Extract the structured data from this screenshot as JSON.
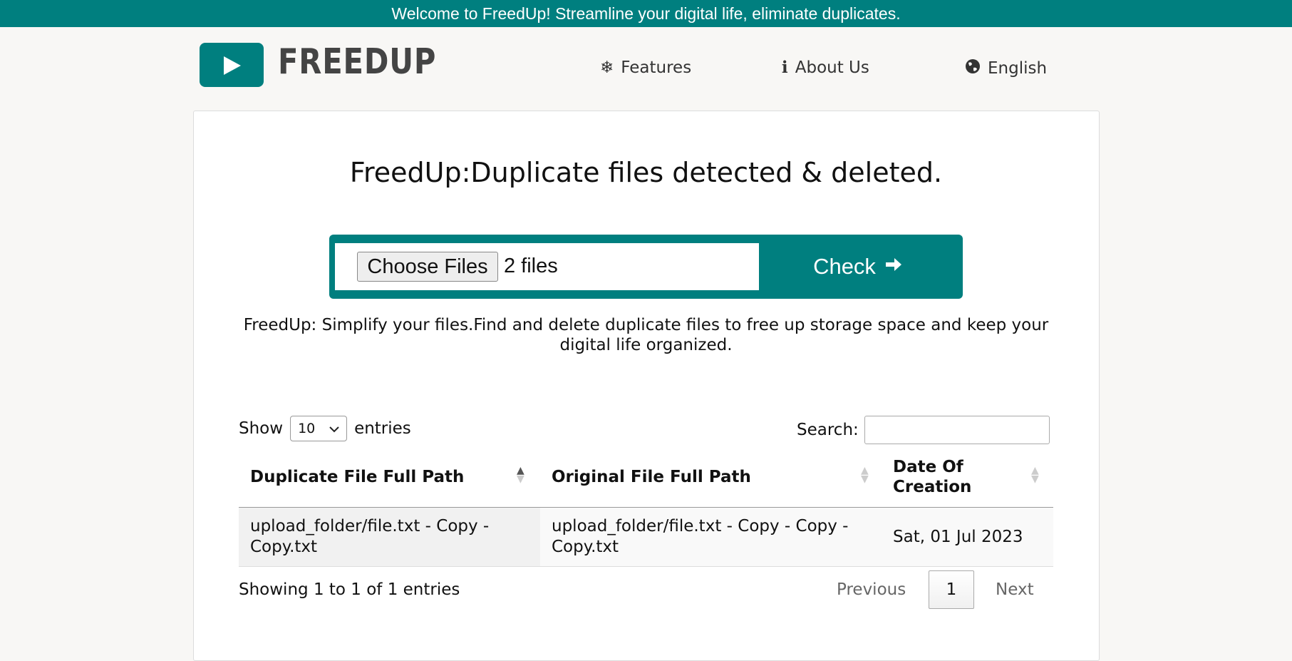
{
  "banner": {
    "text": "Welcome to FreedUp! Streamline your digital life, eliminate duplicates."
  },
  "header": {
    "logo_text": "FREEDUP",
    "nav": [
      {
        "icon": "snowflake-icon",
        "label": "Features"
      },
      {
        "icon": "info-icon",
        "label": "About Us"
      },
      {
        "icon": "globe-icon",
        "label": "English"
      }
    ]
  },
  "main": {
    "title": "FreedUp:Duplicate files detected & deleted.",
    "upload": {
      "choose_label": "Choose Files",
      "files_selected": "2 files",
      "check_label": "Check"
    },
    "description": "FreedUp: Simplify your files.Find and delete duplicate files to free up storage space and keep your digital life organized."
  },
  "table": {
    "show_label": "Show",
    "entries_value": "10",
    "entries_label": "entries",
    "search_label": "Search:",
    "search_value": "",
    "columns": [
      "Duplicate File Full Path",
      "Original File Full Path",
      "Date Of Creation"
    ],
    "rows": [
      [
        "upload_folder/file.txt - Copy - Copy.txt",
        "upload_folder/file.txt - Copy - Copy - Copy.txt",
        "Sat, 01 Jul 2023"
      ]
    ],
    "info": "Showing 1 to 1 of 1 entries",
    "pagination": {
      "previous": "Previous",
      "current": "1",
      "next": "Next"
    }
  },
  "colors": {
    "brand": "#007f7f",
    "background": "#f8f7f5"
  }
}
